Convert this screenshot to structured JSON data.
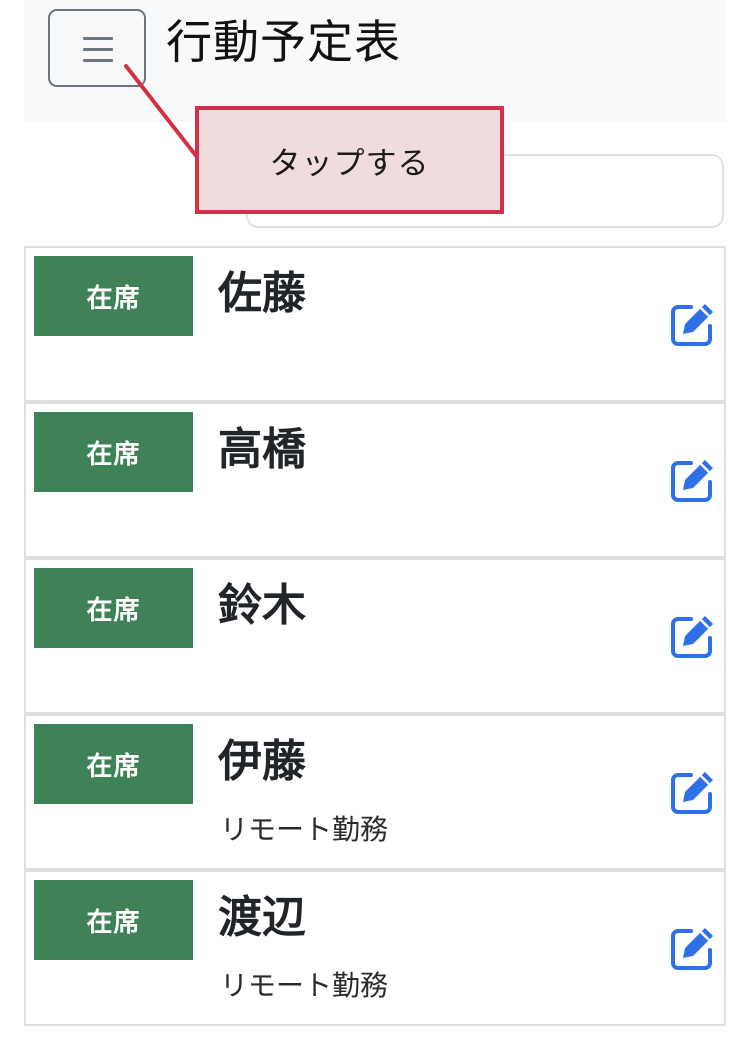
{
  "header": {
    "menu_icon": "hamburger-menu-icon",
    "title": "行動予定表"
  },
  "callout": {
    "text": "タップする",
    "border_color": "#d23148",
    "fill_color": "#f0dcdc"
  },
  "search": {
    "value": "",
    "placeholder": ""
  },
  "colors": {
    "status_present": "#3f8257",
    "edit_icon": "#2f6fe8"
  },
  "members": [
    {
      "status": "在席",
      "name": "佐藤",
      "note": ""
    },
    {
      "status": "在席",
      "name": "高橋",
      "note": ""
    },
    {
      "status": "在席",
      "name": "鈴木",
      "note": ""
    },
    {
      "status": "在席",
      "name": "伊藤",
      "note": "リモート勤務"
    },
    {
      "status": "在席",
      "name": "渡辺",
      "note": "リモート勤務"
    }
  ],
  "edit_icon": "edit-pencil-icon"
}
